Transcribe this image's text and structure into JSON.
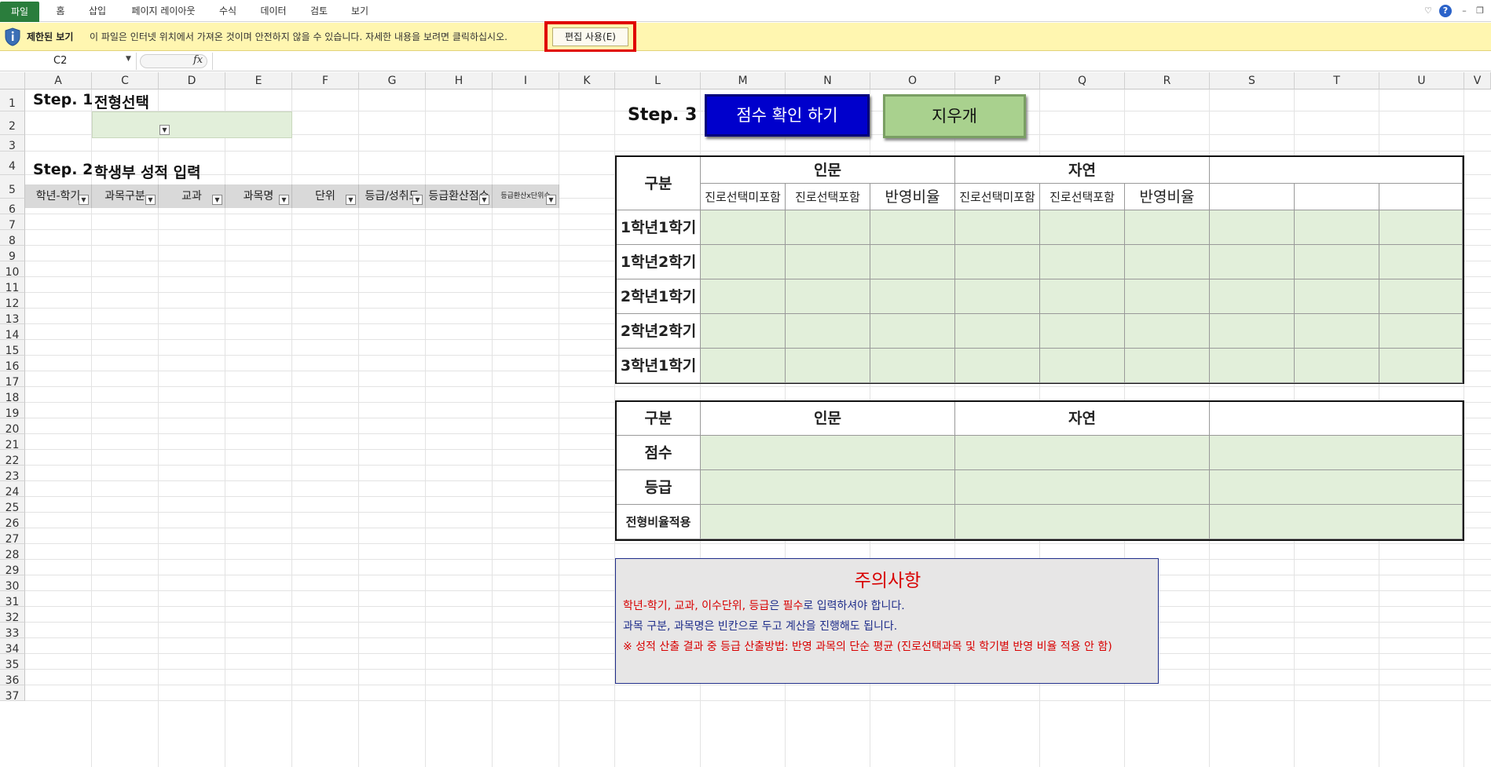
{
  "ribbon": {
    "tabs": [
      "파일",
      "홈",
      "삽입",
      "페이지 레이아웃",
      "수식",
      "데이터",
      "검토",
      "보기"
    ]
  },
  "message_bar": {
    "title": "제한된 보기",
    "text": "이 파일은 인터넷 위치에서 가져온 것이며 안전하지 않을 수 있습니다. 자세한 내용을 보려면 클릭하십시오.",
    "button": "편집 사용(E)",
    "highlight_color": "#e00000"
  },
  "formula_bar": {
    "name_box": "C2",
    "fx": "fx"
  },
  "columns": [
    "A",
    "C",
    "D",
    "E",
    "F",
    "G",
    "H",
    "I",
    "K",
    "L",
    "M",
    "N",
    "O",
    "P",
    "Q",
    "R",
    "S",
    "T",
    "U",
    "V"
  ],
  "rows": [
    "1",
    "2",
    "3",
    "4",
    "5",
    "6",
    "7",
    "8",
    "9",
    "10",
    "11",
    "12",
    "13",
    "14",
    "15",
    "16",
    "17",
    "18",
    "19",
    "20",
    "21",
    "22",
    "23",
    "24",
    "25",
    "26",
    "27",
    "28",
    "29",
    "30",
    "31",
    "32",
    "33",
    "34",
    "35",
    "36",
    "37"
  ],
  "step1": {
    "label": "Step. 1",
    "title": "전형선택"
  },
  "step2": {
    "label": "Step. 2",
    "title": "학생부 성적 입력",
    "headers": [
      "학년-학기",
      "과목구분",
      "교과",
      "과목명",
      "단위",
      "등급/성취도",
      "등급환산점수",
      "등급환산x단위수"
    ]
  },
  "step3": {
    "label": "Step. 3",
    "check_button": "점수 확인 하기",
    "clear_button": "지우개"
  },
  "table1": {
    "corner": "구분",
    "groups": [
      "인문",
      "자연",
      ""
    ],
    "subheaders": [
      "진로선택미포함",
      "진로선택포함",
      "반영비율",
      "진로선택미포함",
      "진로선택포함",
      "반영비율",
      "",
      "",
      ""
    ],
    "rows": [
      "1학년1학기",
      "1학년2학기",
      "2학년1학기",
      "2학년2학기",
      "3학년1학기"
    ]
  },
  "table2": {
    "corner": "구분",
    "groups": [
      "인문",
      "자연",
      ""
    ],
    "rows": [
      "점수",
      "등급",
      "전형비율적용"
    ]
  },
  "notes": {
    "title": "주의사항",
    "line1_red": "학년-학기, 교과, 이수단위, 등급",
    "line1_blue1": "은 ",
    "line1_red2": "필수",
    "line1_blue2": "로 입력하셔야 합니다.",
    "line2": "과목 구분, 과목명은 빈칸으로 두고 계산을 진행해도 됩니다.",
    "line3": "※ 성적 산출 결과 중 등급 산출방법: 반영 과목의 단순 평균 (진로선택과목 및 학기별 반영 비율 적용 안 함)"
  },
  "colors": {
    "file_tab": "#2a7d3c",
    "msg_bar": "#fff6b0",
    "cell_green": "#e2efda",
    "check_button": "#0000cc",
    "clear_button": "#a9d18e",
    "note_title": "#d80000",
    "note_red": "#d80000",
    "note_blue": "#1f2d8a"
  }
}
